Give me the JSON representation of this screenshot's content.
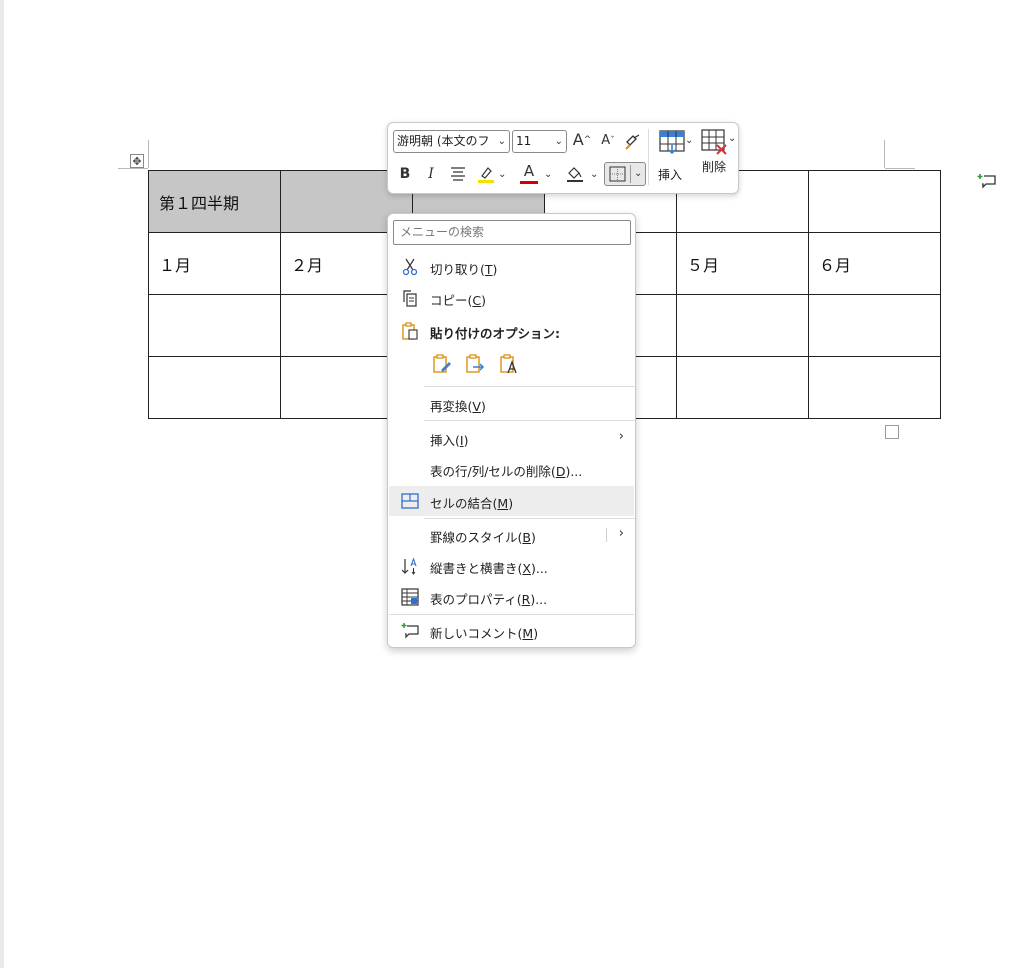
{
  "table": {
    "rows": [
      [
        "第１四半期",
        "",
        "",
        "",
        "",
        ""
      ],
      [
        "１月",
        "２月",
        "",
        "",
        "５月",
        "６月"
      ],
      [
        "",
        "",
        "",
        "",
        "",
        ""
      ],
      [
        "",
        "",
        "",
        "",
        "",
        ""
      ]
    ]
  },
  "mini_toolbar": {
    "font_name": "游明朝 (本文のフ",
    "font_size": "11",
    "bold": "B",
    "italic": "I",
    "font_color_glyph": "A",
    "grow_glyph": "A",
    "shrink_glyph": "A",
    "insert_label": "挿入",
    "delete_label": "削除",
    "colors": {
      "highlight": "#f5e100",
      "font_color": "#d40000"
    }
  },
  "context_menu": {
    "search_placeholder": "メニューの検索",
    "items": {
      "cut": {
        "label": "切り取り(",
        "key": "T",
        "suffix": ")"
      },
      "copy": {
        "label": "コピー(",
        "key": "C",
        "suffix": ")"
      },
      "paste_options": {
        "label": "貼り付けのオプション:"
      },
      "reconvert": {
        "label": "再変換(",
        "key": "V",
        "suffix": ")"
      },
      "insert": {
        "label": "挿入(",
        "key": "I",
        "suffix": ")"
      },
      "delete_cells": {
        "label": "表の行/列/セルの削除(",
        "key": "D",
        "suffix": ")..."
      },
      "merge_cells": {
        "label": "セルの結合(",
        "key": "M",
        "suffix": ")"
      },
      "border_styles": {
        "label": "罫線のスタイル(",
        "key": "B",
        "suffix": ")"
      },
      "text_direction": {
        "label": "縦書きと横書き(",
        "key": "X",
        "suffix": ")..."
      },
      "table_properties": {
        "label": "表のプロパティ(",
        "key": "R",
        "suffix": ")..."
      },
      "new_comment": {
        "label": "新しいコメント(",
        "key": "M",
        "suffix": ")"
      }
    },
    "submenu_arrow": "›"
  }
}
